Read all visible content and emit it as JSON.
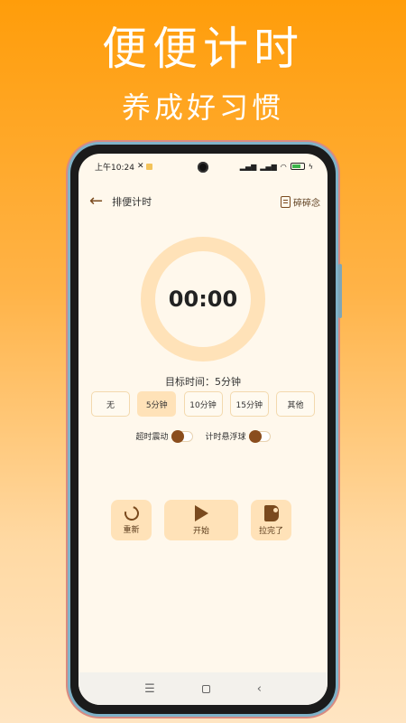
{
  "promo": {
    "title": "便便计时",
    "subtitle": "养成好习惯"
  },
  "status_bar": {
    "time": "上午10:24",
    "battery_level": 0.8
  },
  "header": {
    "title": "排便计时",
    "action_label": "碎碎念"
  },
  "timer": {
    "display": "00:00"
  },
  "target": {
    "text": "目标时间：5分钟"
  },
  "options": [
    {
      "label": "无",
      "active": false
    },
    {
      "label": "5分钟",
      "active": true
    },
    {
      "label": "10分钟",
      "active": false
    },
    {
      "label": "15分钟",
      "active": false
    },
    {
      "label": "其他",
      "active": false
    }
  ],
  "toggles": {
    "overtime_vibrate": {
      "label": "超时震动",
      "on": false
    },
    "floating_ball": {
      "label": "计时悬浮球",
      "on": false
    }
  },
  "controls": {
    "restart_label": "重新",
    "start_label": "开始",
    "done_label": "拉完了"
  },
  "nav": {
    "menu_glyph": "☰",
    "back_glyph": "‹"
  },
  "colors": {
    "accent_brown": "#7a4a1e",
    "accent_light": "#ffe2b8",
    "brand_orange": "#ff9d0a"
  }
}
